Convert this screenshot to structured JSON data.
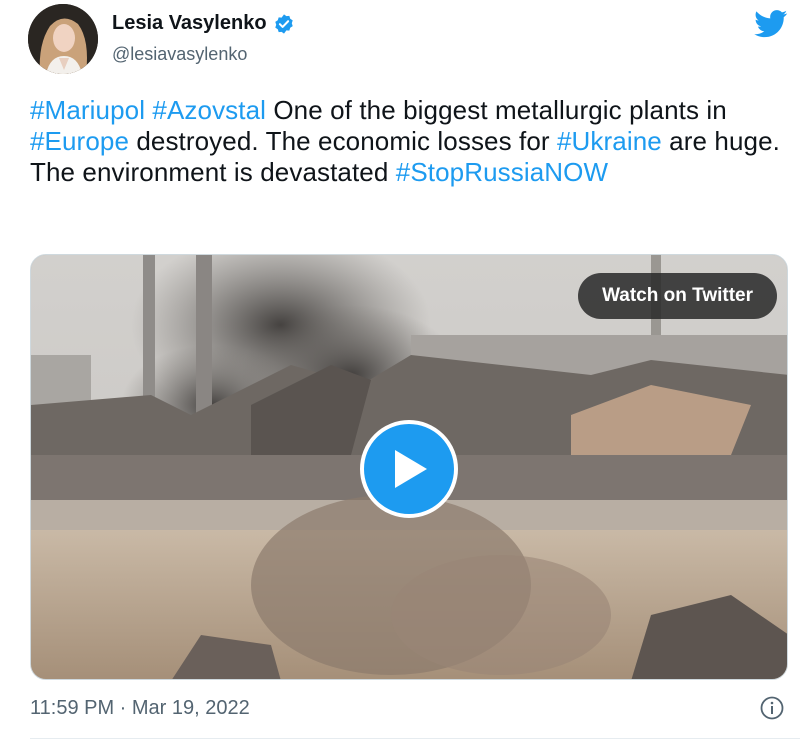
{
  "author": {
    "display_name": "Lesia Vasylenko",
    "handle": "@lesiavasylenko",
    "verified_icon": "verified-badge-icon"
  },
  "tweet": {
    "segments": [
      {
        "text": "#Mariupol",
        "hashtag": true
      },
      {
        "text": " ",
        "hashtag": false
      },
      {
        "text": "#Azovstal",
        "hashtag": true
      },
      {
        "text": " One of the biggest metallurgic plants in ",
        "hashtag": false
      },
      {
        "text": "#Europe",
        "hashtag": true
      },
      {
        "text": " destroyed. The economic losses for ",
        "hashtag": false
      },
      {
        "text": "#Ukraine",
        "hashtag": true
      },
      {
        "text": " are huge. The environment is devastated ",
        "hashtag": false
      },
      {
        "text": "#StopRussiaNOW",
        "hashtag": true
      }
    ]
  },
  "media": {
    "watch_label": "Watch on Twitter",
    "play_icon": "play-icon"
  },
  "footer": {
    "timestamp": "11:59 PM · Mar 19, 2022",
    "info_icon": "info-icon"
  },
  "colors": {
    "accent": "#1d9bf0",
    "text": "#0f1419",
    "muted": "#536471"
  }
}
